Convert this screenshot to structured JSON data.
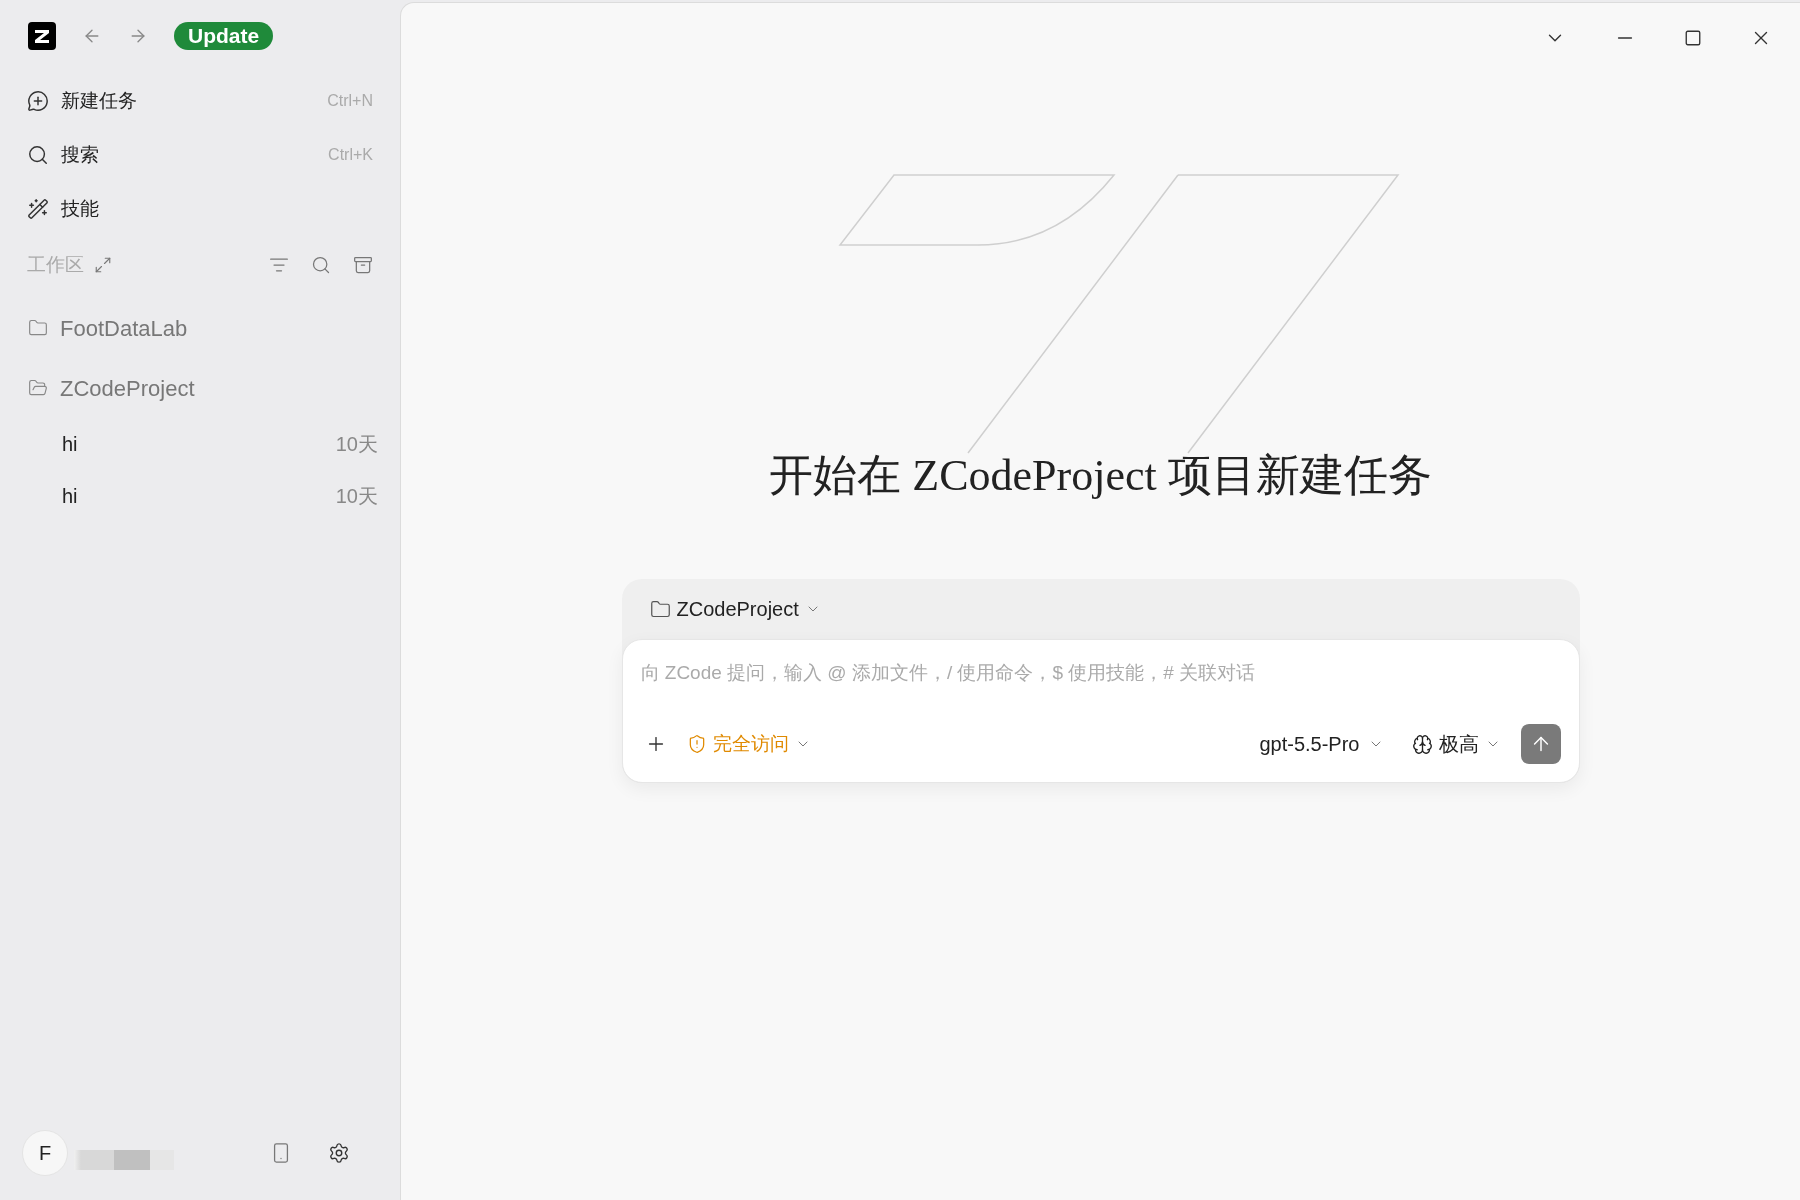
{
  "app": {
    "update_label": "Update"
  },
  "sidebar": {
    "nav": [
      {
        "kind": "new",
        "label": "新建任务",
        "shortcut": "Ctrl+N"
      },
      {
        "kind": "search",
        "label": "搜索",
        "shortcut": "Ctrl+K"
      },
      {
        "kind": "skills",
        "label": "技能"
      }
    ],
    "workspace": {
      "label": "工作区",
      "projects": [
        {
          "name": "FootDataLab",
          "expanded": false
        },
        {
          "name": "ZCodeProject",
          "expanded": true,
          "children": [
            {
              "title": "hi",
              "age": "10天"
            },
            {
              "title": "hi",
              "age": "10天"
            }
          ]
        }
      ]
    },
    "user": {
      "avatar": "F"
    }
  },
  "main": {
    "heading": "开始在 ZCodeProject 项目新建任务",
    "composer": {
      "project": "ZCodeProject",
      "placeholder": "向 ZCode 提问，输入 @ 添加文件，/ 使用命令，$ 使用技能，# 关联对话",
      "access": "完全访问",
      "model": "gpt-5.5-Pro",
      "effort": "极高"
    }
  }
}
